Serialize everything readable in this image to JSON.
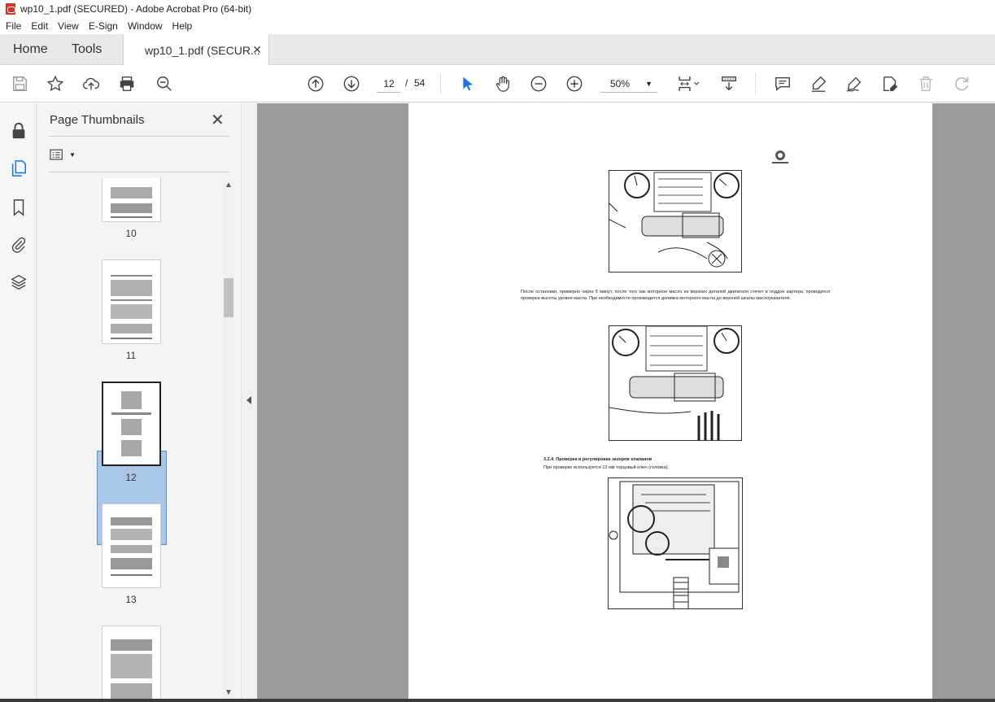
{
  "window": {
    "title": "wp10_1.pdf (SECURED) - Adobe Acrobat Pro (64-bit)"
  },
  "menu": {
    "items": [
      "File",
      "Edit",
      "View",
      "E-Sign",
      "Window",
      "Help"
    ]
  },
  "tabs": {
    "home": "Home",
    "tools": "Tools",
    "doc": "wp10_1.pdf (SECUR..."
  },
  "toolbar": {
    "page_current": "12",
    "page_sep": "/",
    "page_total": "54",
    "zoom": "50%"
  },
  "panel": {
    "title": "Page Thumbnails",
    "thumbnails": [
      {
        "label": "10"
      },
      {
        "label": "11"
      },
      {
        "label": "12",
        "selected": true
      },
      {
        "label": "13"
      },
      {
        "label": ""
      }
    ]
  },
  "document": {
    "paragraph1": "После остановки, примерно через 5 минут, после того как моторное масло из верхних деталей двигателя стечет в поддон картера, проводится проверка высоты уровня масла. При необходимости производится доливка моторного масла до верхней шкалы маслоуказателя.",
    "heading": "3.2.4. Проверка и регулировка зазоров клапанов",
    "paragraph2": "При проверке используется 13 мм торцовый ключ (головка)."
  },
  "icons": {
    "accent": "#1473e6",
    "select_blue": "#aac6e6"
  }
}
